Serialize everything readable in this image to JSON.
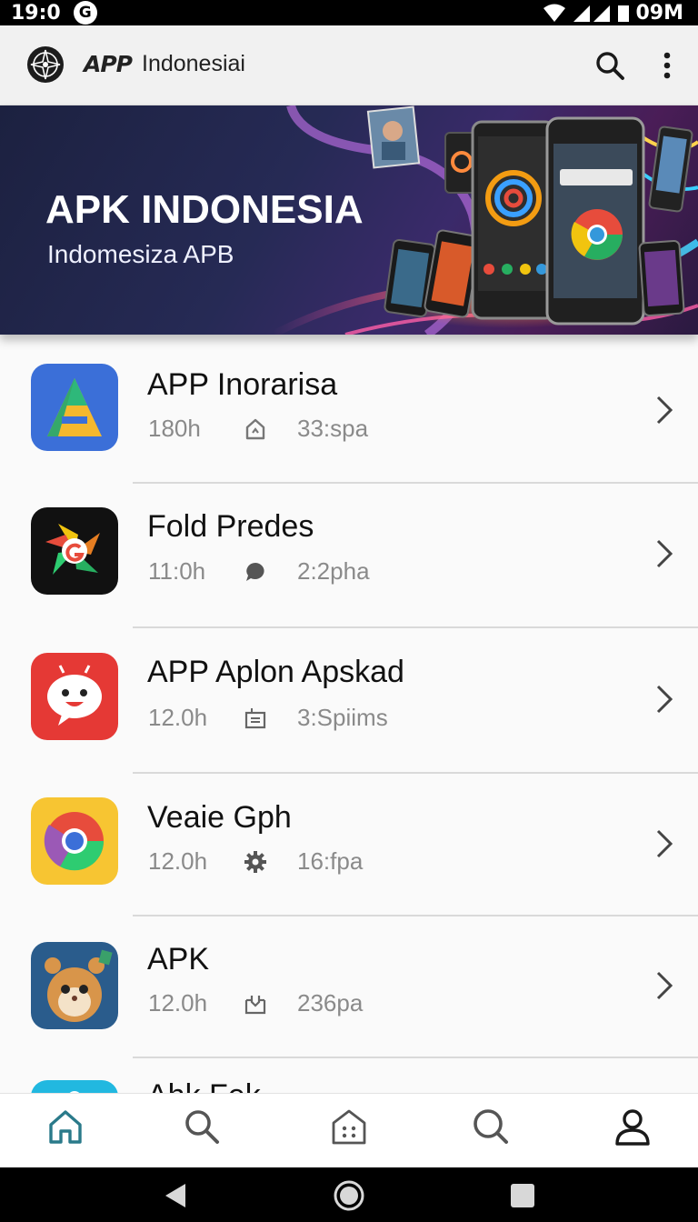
{
  "status_bar": {
    "time": "19:0",
    "logo": "G",
    "right_text": "09M",
    "icons": [
      "wifi-icon",
      "signal-icon",
      "battery-icon"
    ]
  },
  "app_bar": {
    "brand": "APP",
    "title": "Indonesiai",
    "icons": [
      "globe-logo-icon",
      "search-icon",
      "more-vert-icon"
    ]
  },
  "banner": {
    "title": "APK INDONESIA",
    "subtitle": "Indomesiza APB"
  },
  "apps": [
    {
      "name": "APP Inorarisa",
      "time": "180h",
      "meta_icon": "home-up-icon",
      "size": "33:spa",
      "icon": "triangle-a-app-icon",
      "icon_bg": "#3b6fd8"
    },
    {
      "name": "Fold Predes",
      "time": "11:0h",
      "meta_icon": "chat-bubble-icon",
      "size": "2:2pha",
      "icon": "flower-g-app-icon",
      "icon_bg": "#111111"
    },
    {
      "name": "APP Aplon Apskad",
      "time": "12.0h",
      "meta_icon": "inbox-icon",
      "size": "3:Spiims",
      "icon": "smiley-bubble-app-icon",
      "icon_bg": "#e53935"
    },
    {
      "name": "Veaie Gph",
      "time": "12.0h",
      "meta_icon": "gear-icon",
      "size": "16:fpa",
      "icon": "chrome-like-app-icon",
      "icon_bg": "#f7c532"
    },
    {
      "name": "APK",
      "time": "12.0h",
      "meta_icon": "download-box-icon",
      "size": "236pa",
      "icon": "hamster-app-icon",
      "icon_bg": "#2a5c8c"
    },
    {
      "name": "Ahk Fek",
      "time": "",
      "meta_icon": "",
      "size": "",
      "icon": "cyan-app-icon",
      "icon_bg": "#22b8e0"
    }
  ],
  "bottom_nav": {
    "items": [
      "home-icon",
      "search-icon",
      "apps-grid-icon",
      "discover-icon",
      "profile-icon"
    ],
    "active": "home-icon",
    "active_color": "#2a7a8a"
  },
  "system_nav": [
    "back-icon",
    "home-circle-icon",
    "recents-icon"
  ]
}
